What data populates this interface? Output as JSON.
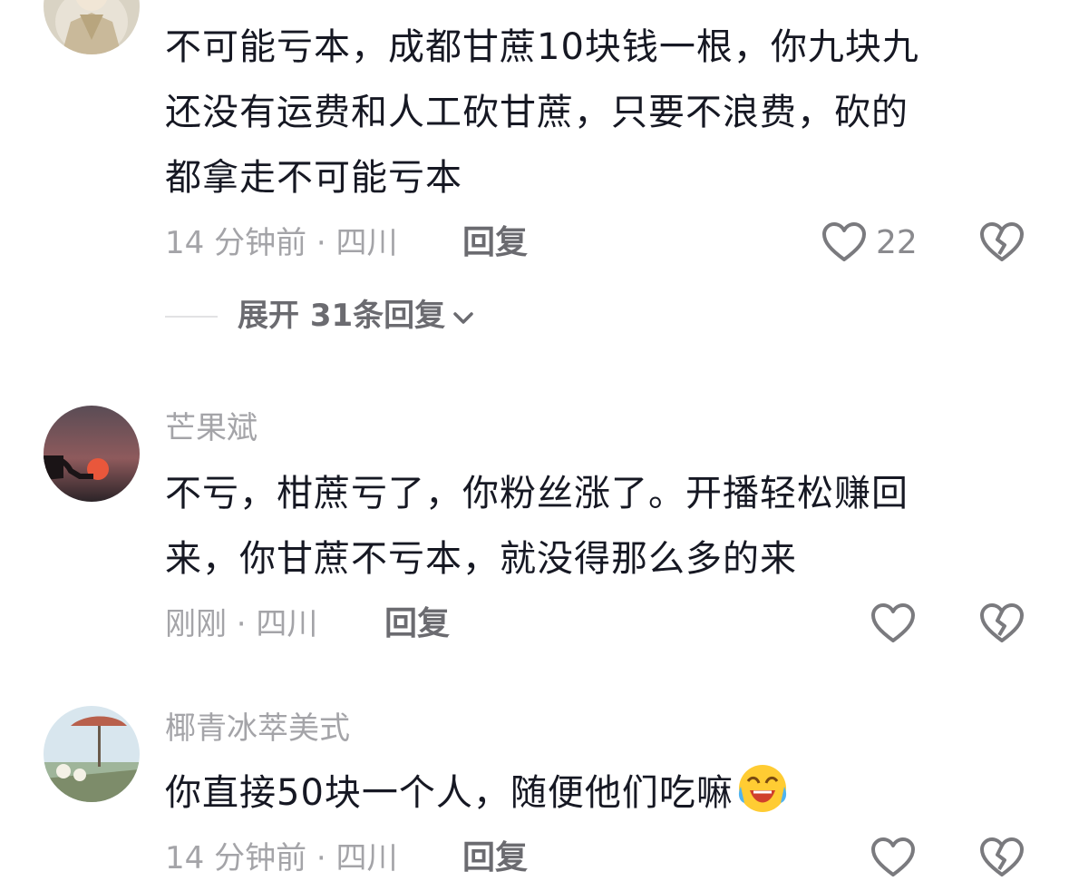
{
  "comments": [
    {
      "username": "",
      "lines": [
        "不可能亏本，成都甘蔗10块钱一根，你九块九",
        "还没有运费和人工砍甘蔗，只要不浪费，砍的",
        "都拿走不可能亏本"
      ],
      "meta": "14 分钟前 · 四川",
      "reply_label": "回复",
      "like_count": "22",
      "expand_label": "展开 31条回复"
    },
    {
      "username": "芒果斌",
      "lines": [
        "不亏，柑蔗亏了，你粉丝涨了。开播轻松赚回",
        "来，你甘蔗不亏本，就没得那么多的来"
      ],
      "meta": "刚刚 · 四川",
      "reply_label": "回复",
      "like_count": ""
    },
    {
      "username": "椰青冰萃美式",
      "lines": [
        "你直接50块一个人，随便他们吃嘛"
      ],
      "emoji": "laughing-crying-emoji",
      "meta": "14 分钟前 · 四川",
      "reply_label": "回复",
      "like_count": ""
    }
  ],
  "icons": {
    "like": "heart-outline-icon",
    "dislike": "broken-heart-icon",
    "expand": "chevron-down-icon"
  },
  "colors": {
    "text": "#161823",
    "secondary": "#a4a4a8",
    "reply": "#6b6b70",
    "icon": "#7a7a7e"
  }
}
